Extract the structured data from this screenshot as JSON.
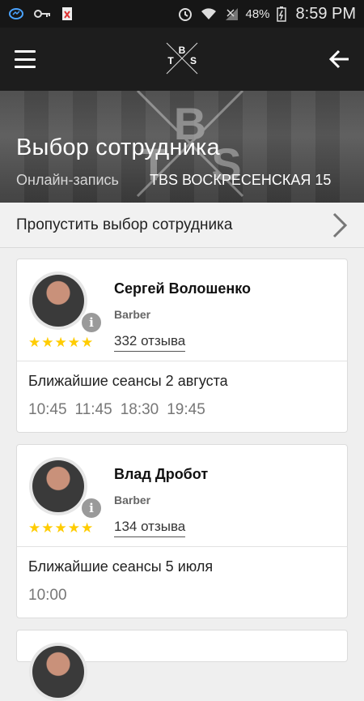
{
  "status_bar": {
    "battery": "48%",
    "time": "8:59 PM"
  },
  "app_bar": {
    "logo_letters": [
      "T",
      "B",
      "S"
    ]
  },
  "hero": {
    "title": "Выбор сотрудника",
    "subtitle": "Онлайн-запись",
    "address": "TBS ВОСКРЕСЕНСКАЯ 15"
  },
  "skip": {
    "label": "Пропустить выбор сотрудника"
  },
  "employees": [
    {
      "name": "Сергей Волошенко",
      "role": "Barber",
      "reviews": "332 отзыва",
      "rating": 5,
      "sessions_title": "Ближайшие сеансы 2 августа",
      "slots": [
        "10:45",
        "11:45",
        "18:30",
        "19:45"
      ]
    },
    {
      "name": "Влад Дробот",
      "role": "Barber",
      "reviews": "134 отзыва",
      "rating": 5,
      "sessions_title": "Ближайшие сеансы 5 июля",
      "slots": [
        "10:00"
      ]
    }
  ],
  "colors": {
    "star": "#ffcc00",
    "app_bar": "#1d1d1d"
  }
}
